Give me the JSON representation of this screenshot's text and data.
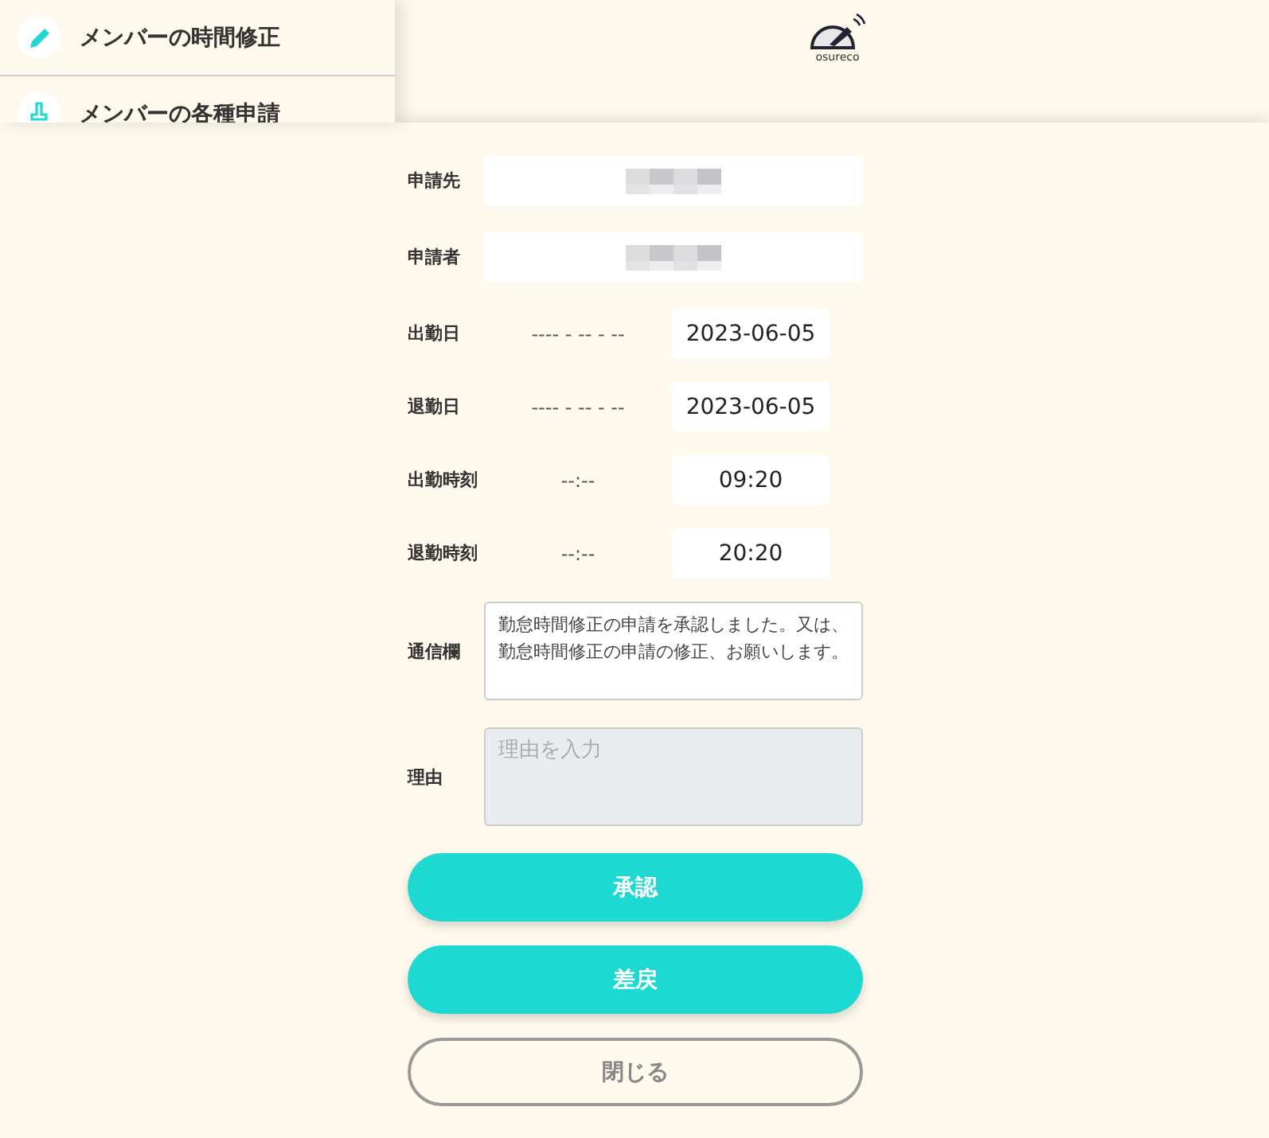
{
  "sidebar": {
    "items": [
      {
        "label": "メンバーの時間修正",
        "kind": "pencil"
      },
      {
        "label": "メンバーの各種申請",
        "kind": "stamp"
      }
    ]
  },
  "logo": {
    "text": "osureco"
  },
  "form": {
    "fields": [
      {
        "kind": "name",
        "label": "申請先"
      },
      {
        "kind": "name",
        "label": "申請者"
      },
      {
        "kind": "pair",
        "label": "出勤日",
        "empty_value": "---- - -- - --",
        "value": "2023-06-05"
      },
      {
        "kind": "pair",
        "label": "退勤日",
        "empty_value": "---- - -- - --",
        "value": "2023-06-05"
      },
      {
        "kind": "pair",
        "label": "出勤時刻",
        "empty_value": "--:--",
        "value": "09:20"
      },
      {
        "kind": "pair",
        "label": "退勤時刻",
        "empty_value": "--:--",
        "value": "20:20"
      },
      {
        "kind": "text",
        "label": "通信欄",
        "value": "勤怠時間修正の申請を承認しました。又は、勤怠時間修正の申請の修正、お願いします。",
        "disabled": false
      },
      {
        "kind": "text",
        "label": "理由",
        "placeholder": "理由を入力",
        "disabled": true
      }
    ]
  },
  "buttons": [
    {
      "label": "承認",
      "kind": "primary"
    },
    {
      "label": "差戻",
      "kind": "primary"
    },
    {
      "label": "閉じる",
      "kind": "outline"
    }
  ]
}
